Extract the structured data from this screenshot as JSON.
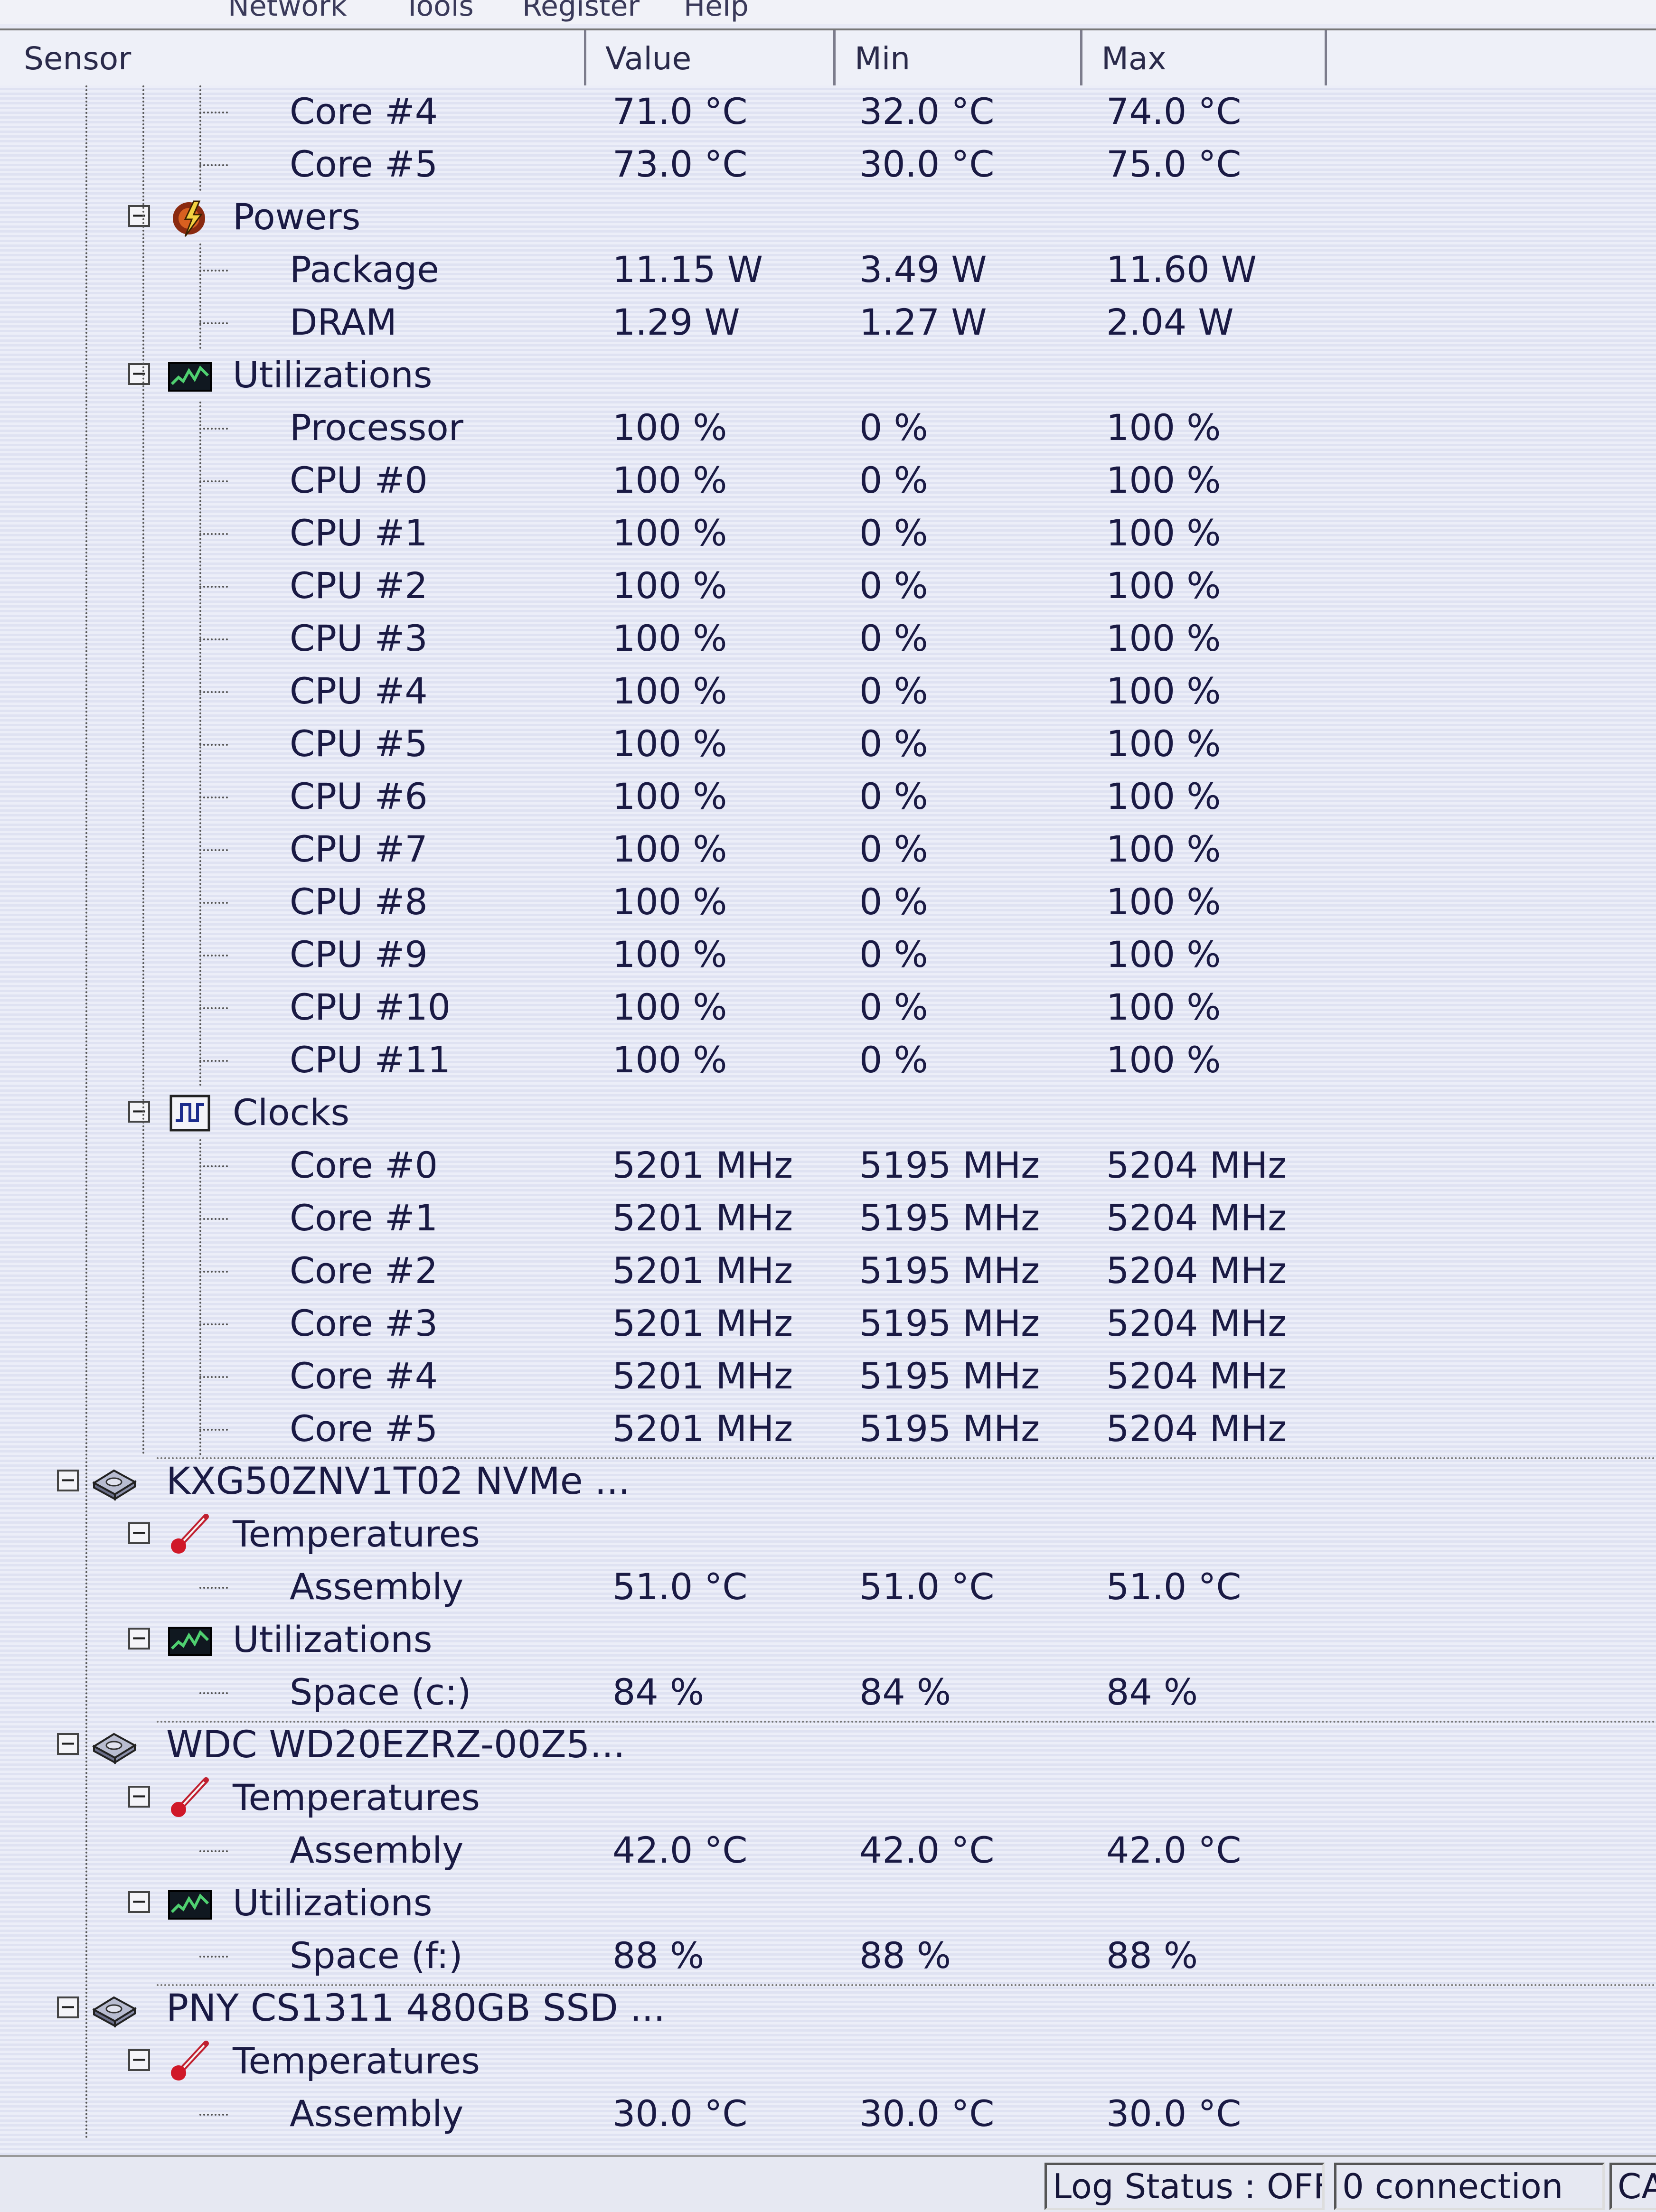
{
  "menubar": {
    "items": [
      "Network",
      "Tools",
      "Register",
      "Help"
    ]
  },
  "columns": {
    "sensor": "Sensor",
    "value": "Value",
    "min": "Min",
    "max": "Max"
  },
  "rows": [
    {
      "level": 3,
      "label": "Core #4",
      "value": "71.0 °C",
      "min": "32.0 °C",
      "max": "74.0 °C"
    },
    {
      "level": 3,
      "label": "Core #5",
      "value": "73.0 °C",
      "min": "30.0 °C",
      "max": "75.0 °C"
    },
    {
      "level": 2,
      "label": "Powers",
      "icon": "power-icon",
      "expanded": true
    },
    {
      "level": 3,
      "label": "Package",
      "value": "11.15 W",
      "min": "3.49 W",
      "max": "11.60 W"
    },
    {
      "level": 3,
      "label": "DRAM",
      "value": "1.29 W",
      "min": "1.27 W",
      "max": "2.04 W"
    },
    {
      "level": 2,
      "label": "Utilizations",
      "icon": "utilization-icon",
      "expanded": true
    },
    {
      "level": 3,
      "label": "Processor",
      "value": "100 %",
      "min": "0 %",
      "max": "100 %"
    },
    {
      "level": 3,
      "label": "CPU #0",
      "value": "100 %",
      "min": "0 %",
      "max": "100 %"
    },
    {
      "level": 3,
      "label": "CPU #1",
      "value": "100 %",
      "min": "0 %",
      "max": "100 %"
    },
    {
      "level": 3,
      "label": "CPU #2",
      "value": "100 %",
      "min": "0 %",
      "max": "100 %"
    },
    {
      "level": 3,
      "label": "CPU #3",
      "value": "100 %",
      "min": "0 %",
      "max": "100 %"
    },
    {
      "level": 3,
      "label": "CPU #4",
      "value": "100 %",
      "min": "0 %",
      "max": "100 %"
    },
    {
      "level": 3,
      "label": "CPU #5",
      "value": "100 %",
      "min": "0 %",
      "max": "100 %"
    },
    {
      "level": 3,
      "label": "CPU #6",
      "value": "100 %",
      "min": "0 %",
      "max": "100 %"
    },
    {
      "level": 3,
      "label": "CPU #7",
      "value": "100 %",
      "min": "0 %",
      "max": "100 %"
    },
    {
      "level": 3,
      "label": "CPU #8",
      "value": "100 %",
      "min": "0 %",
      "max": "100 %"
    },
    {
      "level": 3,
      "label": "CPU #9",
      "value": "100 %",
      "min": "0 %",
      "max": "100 %"
    },
    {
      "level": 3,
      "label": "CPU #10",
      "value": "100 %",
      "min": "0 %",
      "max": "100 %"
    },
    {
      "level": 3,
      "label": "CPU #11",
      "value": "100 %",
      "min": "0 %",
      "max": "100 %"
    },
    {
      "level": 2,
      "label": "Clocks",
      "icon": "clock-icon",
      "expanded": true
    },
    {
      "level": 3,
      "label": "Core #0",
      "value": "5201 MHz",
      "min": "5195 MHz",
      "max": "5204 MHz"
    },
    {
      "level": 3,
      "label": "Core #1",
      "value": "5201 MHz",
      "min": "5195 MHz",
      "max": "5204 MHz"
    },
    {
      "level": 3,
      "label": "Core #2",
      "value": "5201 MHz",
      "min": "5195 MHz",
      "max": "5204 MHz"
    },
    {
      "level": 3,
      "label": "Core #3",
      "value": "5201 MHz",
      "min": "5195 MHz",
      "max": "5204 MHz"
    },
    {
      "level": 3,
      "label": "Core #4",
      "value": "5201 MHz",
      "min": "5195 MHz",
      "max": "5204 MHz"
    },
    {
      "level": 3,
      "label": "Core #5",
      "value": "5201 MHz",
      "min": "5195 MHz",
      "max": "5204 MHz"
    },
    {
      "level": 1,
      "label": "KXG50ZNV1T02 NVMe ...",
      "icon": "drive-icon",
      "expanded": true
    },
    {
      "level": 2,
      "label": "Temperatures",
      "icon": "thermometer-icon",
      "expanded": true
    },
    {
      "level": 3,
      "label": "Assembly",
      "value": "51.0 °C",
      "min": "51.0 °C",
      "max": "51.0 °C"
    },
    {
      "level": 2,
      "label": "Utilizations",
      "icon": "utilization-icon",
      "expanded": true
    },
    {
      "level": 3,
      "label": "Space (c:)",
      "value": "84 %",
      "min": "84 %",
      "max": "84 %"
    },
    {
      "level": 1,
      "label": "WDC WD20EZRZ-00Z5...",
      "icon": "drive-icon",
      "expanded": true
    },
    {
      "level": 2,
      "label": "Temperatures",
      "icon": "thermometer-icon",
      "expanded": true
    },
    {
      "level": 3,
      "label": "Assembly",
      "value": "42.0 °C",
      "min": "42.0 °C",
      "max": "42.0 °C"
    },
    {
      "level": 2,
      "label": "Utilizations",
      "icon": "utilization-icon",
      "expanded": true
    },
    {
      "level": 3,
      "label": "Space (f:)",
      "value": "88 %",
      "min": "88 %",
      "max": "88 %"
    },
    {
      "level": 1,
      "label": "PNY CS1311 480GB SSD ...",
      "icon": "drive-icon",
      "expanded": true
    },
    {
      "level": 2,
      "label": "Temperatures",
      "icon": "thermometer-icon",
      "expanded": true
    },
    {
      "level": 3,
      "label": "Assembly",
      "value": "30.0 °C",
      "min": "30.0 °C",
      "max": "30.0 °C"
    }
  ],
  "statusbar": {
    "log_status": "Log Status : OFF",
    "connection": "0 connection",
    "caps": "CA"
  }
}
